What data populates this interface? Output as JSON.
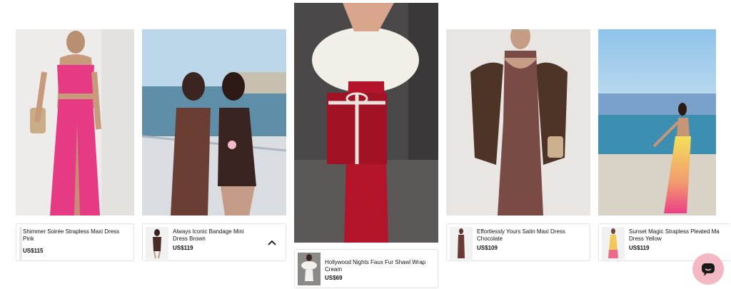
{
  "products": [
    {
      "name": "Shimmer Soirée Strapless Maxi Dress Pink",
      "price": "US$115"
    },
    {
      "name": "Always Iconic Bandage Mini Dress Brown",
      "price": "US$119"
    },
    {
      "name": "Hollywood Nights Faux Fur Shawl Wrap Cream",
      "price": "US$69"
    },
    {
      "name": "Effortlessly Yours Satin Maxi Dress Chocolate",
      "price": "US$109"
    },
    {
      "name": "Sunset Magic Strapless Pleated Ma Dress Yellow",
      "price": "US$119"
    }
  ],
  "icons": {
    "collapse": "chevron-up-icon",
    "chat": "chat-icon"
  },
  "colors": {
    "pink_dress": "#e63a84",
    "brown_dress": "#6b3e34",
    "red_gift": "#b3142a",
    "chocolate_dress": "#7a4a45",
    "chat_button": "#f2b9c2"
  }
}
